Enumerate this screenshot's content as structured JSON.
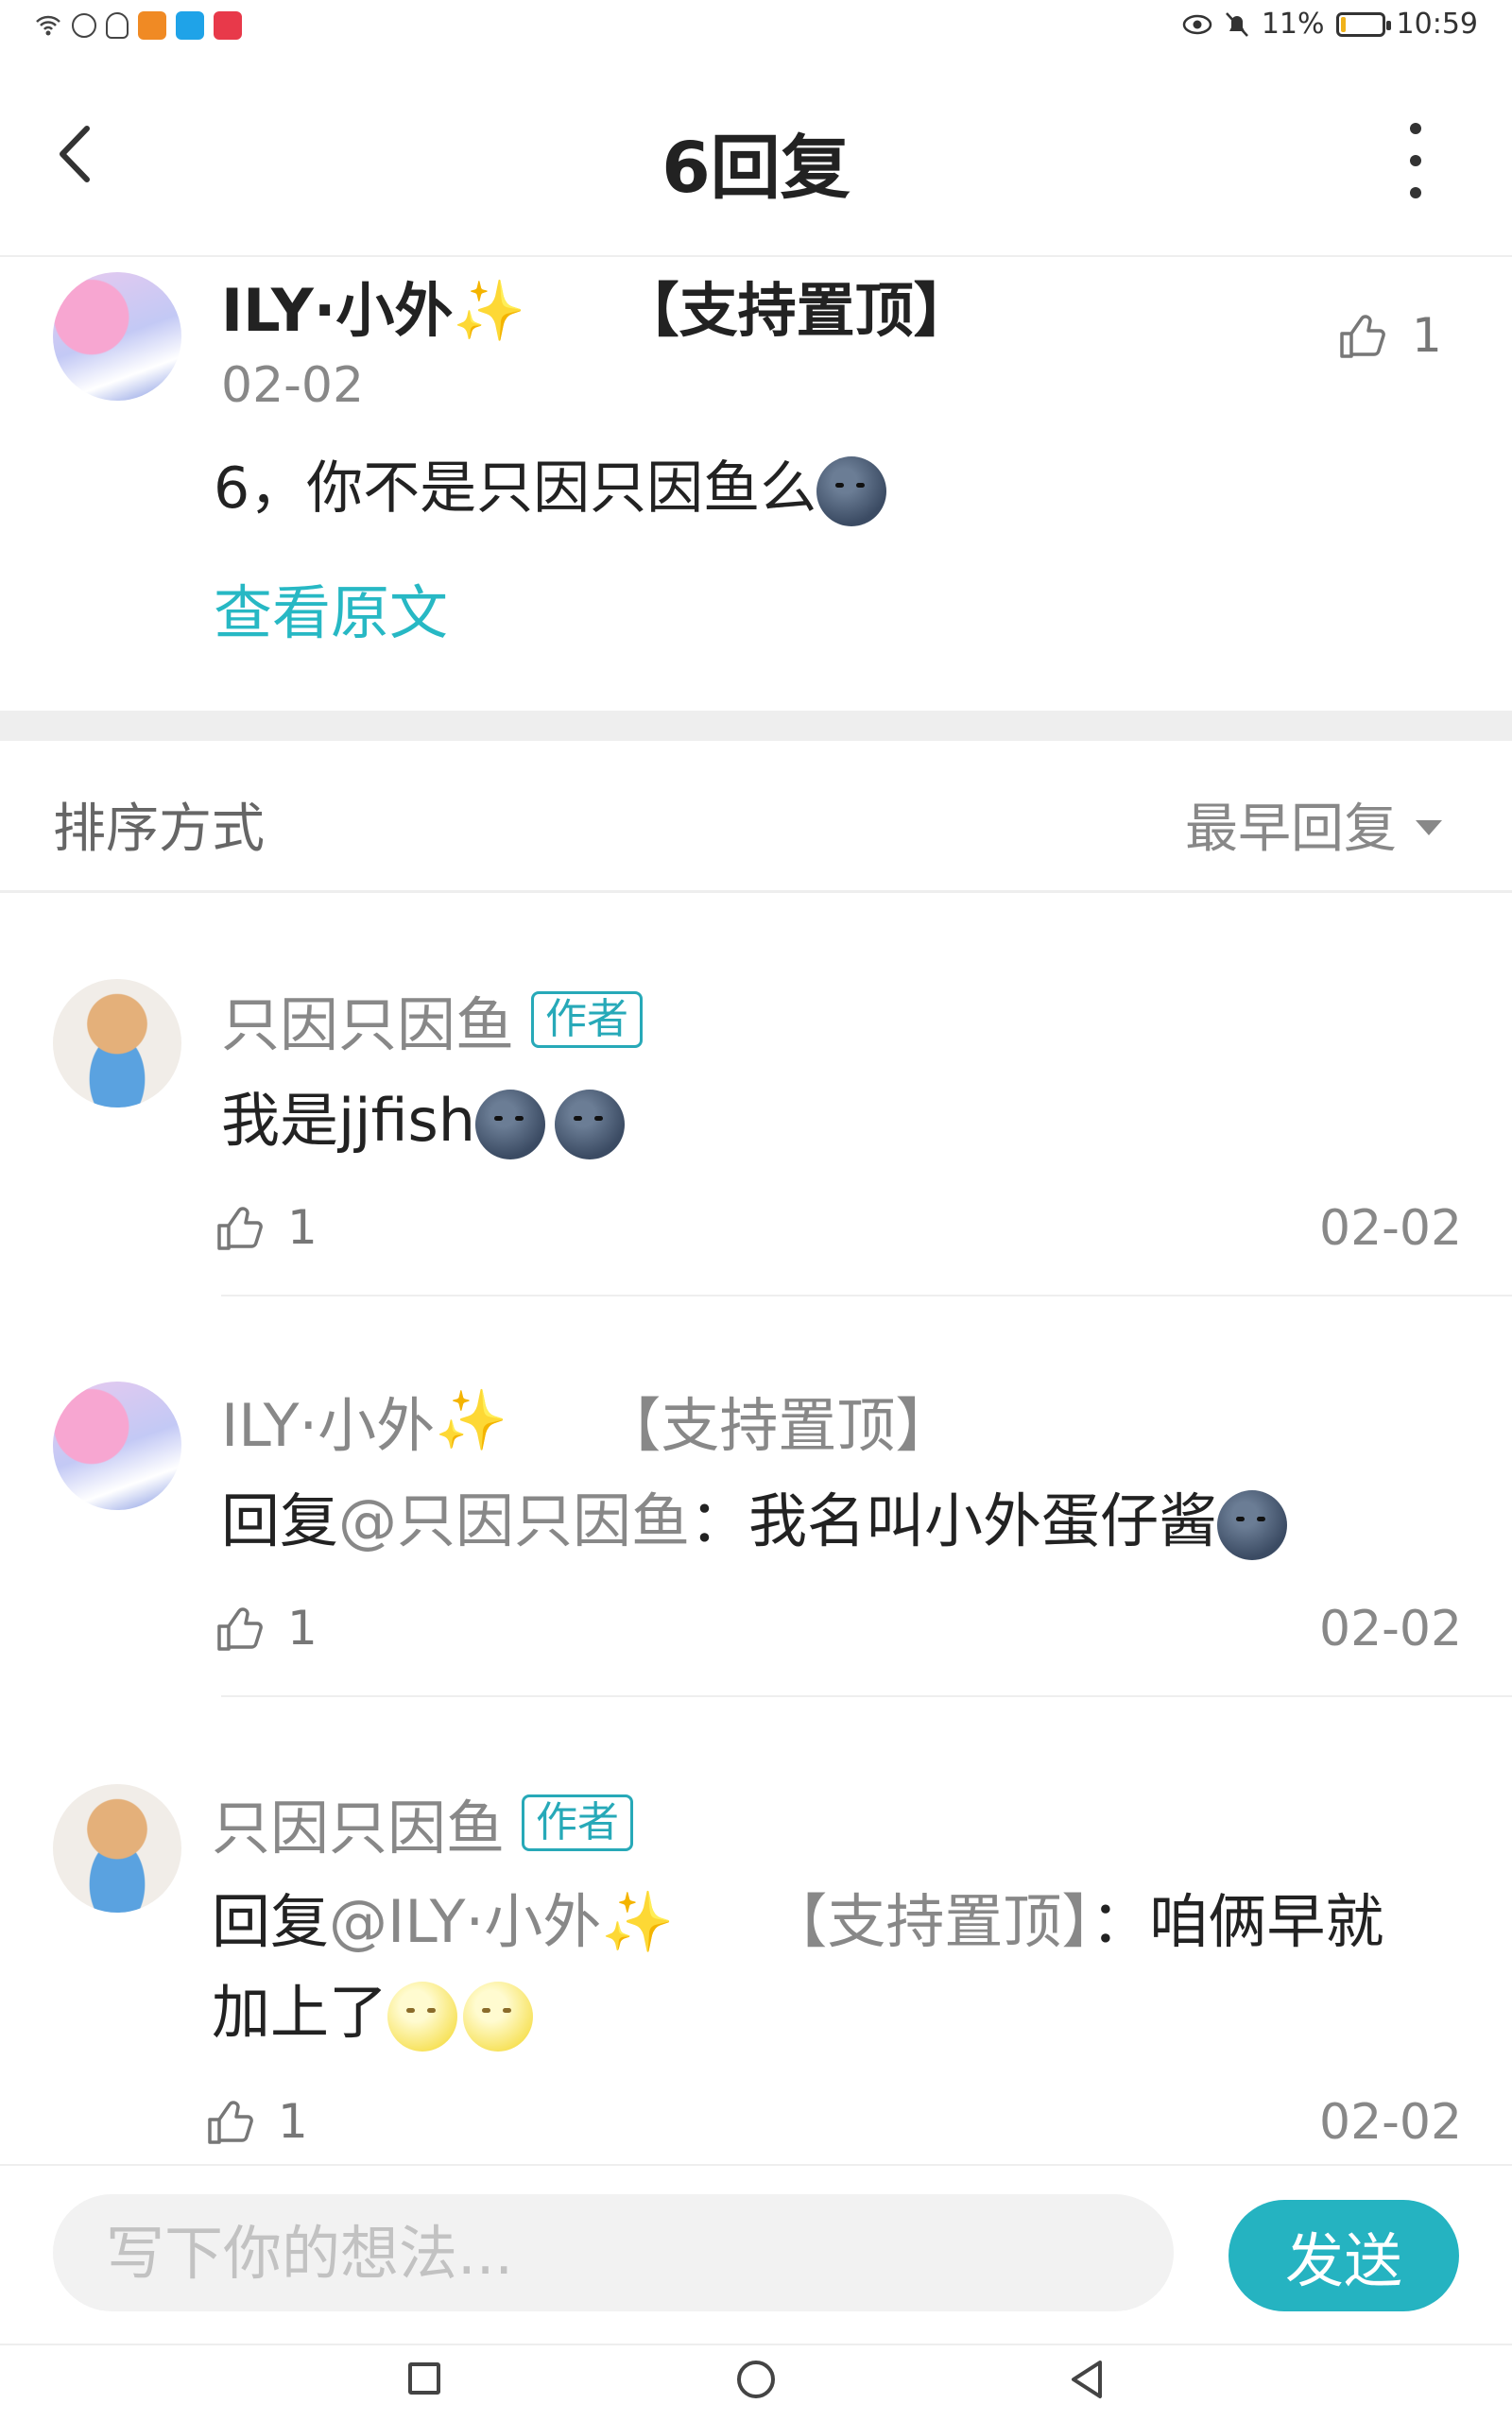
{
  "status_bar": {
    "battery": "11%",
    "time": "10:59",
    "battery_level": 0.11
  },
  "header": {
    "title": "6回复",
    "back_icon": "chevron-left-icon",
    "more_icon": "more-vertical-icon"
  },
  "original_post": {
    "author": "ILY·小外",
    "author_suffix": "✨",
    "author_tag": "【支持置顶】",
    "date": "02-02",
    "text": "6，你不是只因只因鱼么",
    "emoji": "moon-face",
    "view_original": "查看原文",
    "likes": "1"
  },
  "sort": {
    "label": "排序方式",
    "value": "最早回复"
  },
  "replies": [
    {
      "author": "只因只因鱼",
      "badge": "作者",
      "text": "我是jjfish",
      "likes": "1",
      "date": "02-02"
    },
    {
      "author": "ILY·小外",
      "author_suffix": "✨",
      "author_tag": "【支持置顶】",
      "reply_prefix": "回复",
      "mention": "@只因只因鱼",
      "text": "：我名叫小外蛋仔酱",
      "likes": "1",
      "date": "02-02"
    },
    {
      "author": "只因只因鱼",
      "badge": "作者",
      "reply_prefix": "回复",
      "mention": "@ILY·小外",
      "mention_suffix": "✨",
      "mention_tag": "【支持置顶】",
      "text": "：咱俩早就加上了",
      "likes": "1",
      "date": "02-02"
    }
  ],
  "composer": {
    "placeholder": "写下你的想法...",
    "send_label": "发送"
  },
  "colors": {
    "accent": "#25b3c1",
    "link": "#27b8c4",
    "muted": "#888888"
  }
}
